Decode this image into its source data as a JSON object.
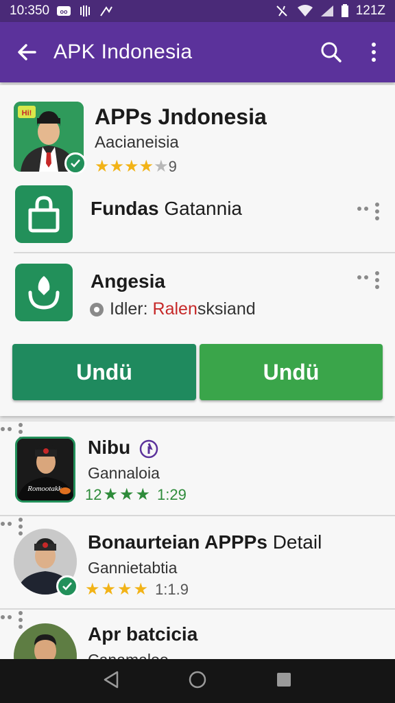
{
  "status_bar": {
    "time": "10:350",
    "right_text": "121Z",
    "icons": [
      "notification-icon",
      "vibrate-icon",
      "signal-icon",
      "nfc-icon",
      "wifi-icon",
      "cell-signal-icon",
      "battery-icon"
    ]
  },
  "app_bar": {
    "title": "APK Indonesia",
    "icons": [
      "back-arrow-icon",
      "search-icon",
      "more-vert-icon"
    ],
    "color": "#5b329b"
  },
  "featured": {
    "name": "APPs Jndonesia",
    "subtitle": "Aacianeisia",
    "rating_count": "9",
    "stars": 4,
    "avatar_badge": "Hi!"
  },
  "rows": [
    {
      "title_bold": "Fundas",
      "title_light": "Gatannia",
      "icon": "bag-icon"
    },
    {
      "title_bold": "Angesia",
      "detail_prefix": "Idler:",
      "detail_red": "Ralen",
      "detail_rest": "sksiand",
      "icon": "download-icon"
    }
  ],
  "buttons": [
    {
      "label": "Undü",
      "color": "#1f8a5e"
    },
    {
      "label": "Undü",
      "color": "#3aa54a"
    }
  ],
  "list": [
    {
      "name": "Nibu",
      "subtitle": "Gannaloia",
      "meta_prefix": "12",
      "meta_time": "1:29",
      "stars": 3,
      "shirt_text": "Romootakk",
      "icon": "info-icon"
    },
    {
      "name_bold": "Bonaurteian APPPs",
      "name_light": "Detail",
      "subtitle": "Gannietabtia",
      "meta_time": "1:1.9",
      "stars": 4
    },
    {
      "name": "Apr batcicia",
      "subtitle": "Canamaloo"
    }
  ],
  "nav": {
    "icons": [
      "back-triangle-icon",
      "home-circle-icon",
      "recents-square-icon"
    ]
  },
  "colors": {
    "accent_green": "#22905a",
    "star": "#f2b317",
    "red_text": "#c62828"
  }
}
